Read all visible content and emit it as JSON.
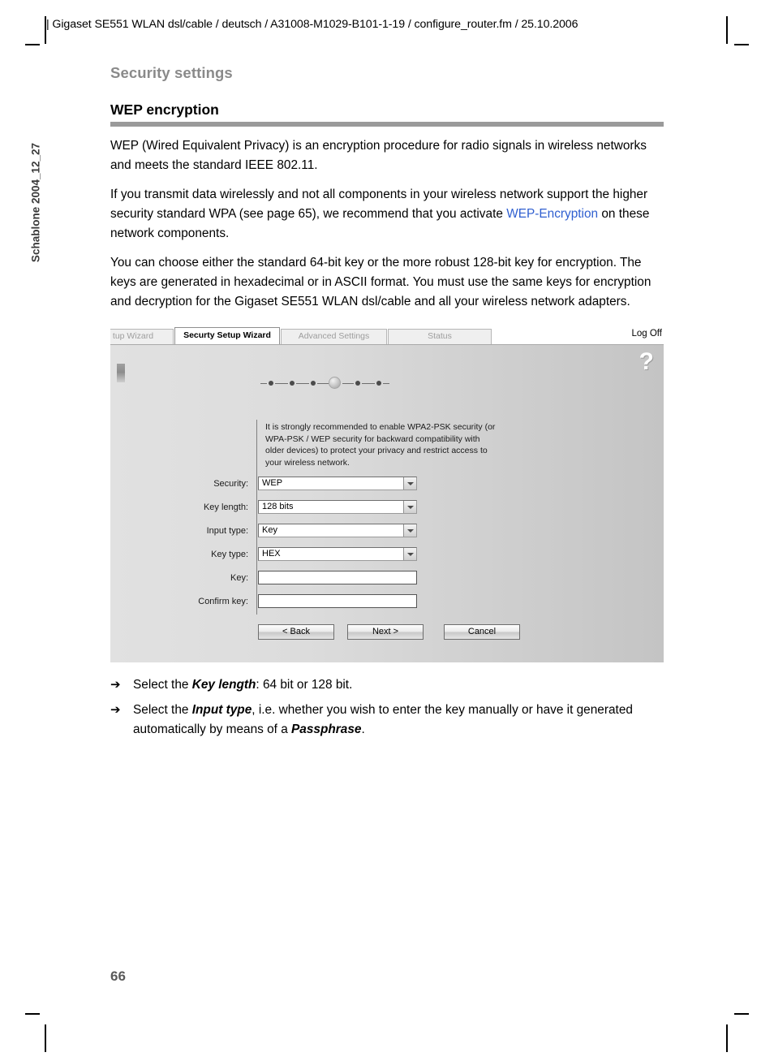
{
  "header": {
    "running_head": "| Gigaset SE551 WLAN dsl/cable / deutsch / A31008-M1029-B101-1-19 / configure_router.fm / 25.10.2006"
  },
  "margin": {
    "template_label": "Schablone 2004_12_27"
  },
  "titles": {
    "chapter": "Security settings",
    "section": "WEP encryption"
  },
  "body": {
    "p1": "WEP (Wired Equivalent Privacy) is an encryption procedure for radio signals in wireless networks and meets the standard IEEE 802.11.",
    "p2_a": "If you transmit data wirelessly and not all components in your wireless network support the higher security standard WPA (see page 65), we recommend that you activate ",
    "p2_link": "WEP-Encryption",
    "p2_b": " on these network components.",
    "p3": "You can choose either the standard 64-bit key or the more robust 128-bit key for encryption. The keys are generated in hexadecimal or in ASCII format. You must use the same keys for encryption and decryption for the Gigaset SE551 WLAN dsl/cable and all your wireless network adapters."
  },
  "screenshot": {
    "tabs": [
      {
        "label": "tup Wizard",
        "active": false
      },
      {
        "label": "Securty Setup Wizard",
        "active": true
      },
      {
        "label": "Advanced Settings",
        "active": false
      },
      {
        "label": "Status",
        "active": false
      }
    ],
    "logoff_label": "Log Off",
    "help_glyph": "?",
    "wizard_steps": {
      "total": 6,
      "current": 4
    },
    "intro_text": "It is strongly recommended to enable WPA2-PSK security (or WPA-PSK / WEP security for backward compatibility with older devices) to protect your privacy and restrict access to your wireless network.",
    "fields": [
      {
        "label": "Security:",
        "value": "WEP",
        "type": "select"
      },
      {
        "label": "Key length:",
        "value": "128 bits",
        "type": "select"
      },
      {
        "label": "Input type:",
        "value": "Key",
        "type": "select"
      },
      {
        "label": "Key type:",
        "value": "HEX",
        "type": "select"
      },
      {
        "label": "Key:",
        "value": "",
        "type": "text"
      },
      {
        "label": "Confirm key:",
        "value": "",
        "type": "text"
      }
    ],
    "buttons": {
      "back": "< Back",
      "next": "Next >",
      "cancel": "Cancel"
    }
  },
  "bullets": [
    {
      "marker": "➔",
      "a": "Select the ",
      "b": "Key length",
      "c": ": 64 bit or 128 bit.",
      "d": "",
      "e": ""
    },
    {
      "marker": "➔",
      "a": "Select the ",
      "b": "Input type",
      "c": ", i.e. whether you wish to enter the key manually or have it generated automatically by means of a ",
      "d": "Passphrase",
      "e": "."
    }
  ],
  "folio": {
    "page_number": "66"
  },
  "colors": {
    "link": "#2f5fd0",
    "chapter_title": "#8a8a8a",
    "rule": "#9a9a9a",
    "folio": "#5a5a5a"
  }
}
